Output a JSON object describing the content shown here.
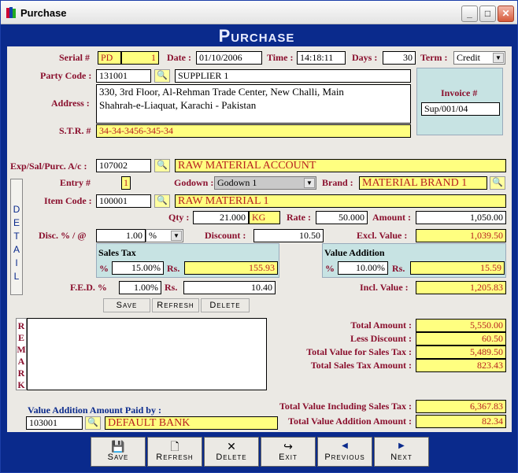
{
  "window": {
    "title": "Purchase"
  },
  "banner": "Purchase",
  "header": {
    "serial_label": "Serial #",
    "serial_prefix": "PD",
    "serial_no": "1",
    "date_label": "Date :",
    "date": "01/10/2006",
    "time_label": "Time :",
    "time": "14:18:11",
    "days_label": "Days :",
    "days": "30",
    "term_label": "Term :",
    "term": "Credit"
  },
  "party": {
    "code_label": "Party Code :",
    "code": "131001",
    "name": "SUPPLIER 1",
    "address_label": "Address :",
    "address_line1": "330, 3rd Floor, Al-Rehman Trade Center, New Challi, Main",
    "address_line2": "Shahrah-e-Liaquat, Karachi - Pakistan",
    "str_label": "S.T.R. #",
    "str": "34-34-3456-345-34"
  },
  "invoice": {
    "label": "Invoice #",
    "value": "Sup/001/04"
  },
  "account": {
    "label": "Exp/Sal/Purc. A/c :",
    "code": "107002",
    "name": "RAW MATERIAL ACCOUNT"
  },
  "detail": {
    "tab_letters": [
      "D",
      "E",
      "T",
      "A",
      "I",
      "L"
    ],
    "entry_label": "Entry #",
    "entry": "1",
    "godown_label": "Godown :",
    "godown": "Godown 1",
    "brand_label": "Brand :",
    "brand": "MATERIAL BRAND 1",
    "item_label": "Item Code :",
    "item_code": "100001",
    "item_name": "RAW MATERIAL 1",
    "qty_label": "Qty :",
    "qty": "21.000",
    "unit": "KG",
    "rate_label": "Rate :",
    "rate": "50.000",
    "amount_label": "Amount :",
    "amount": "1,050.00",
    "disc_label": "Disc. % / @",
    "disc": "1.00",
    "disc_type": "%",
    "discount_label": "Discount :",
    "discount": "10.50",
    "excl_label": "Excl. Value :",
    "excl": "1,039.50",
    "sales_tax_title": "Sales Tax",
    "pct_label": "%",
    "st_pct": "15.00%",
    "rs_label": "Rs.",
    "st_rs": "155.93",
    "va_title": "Value Addition",
    "va_pct": "10.00%",
    "va_rs": "15.59",
    "fed_label": "F.E.D. %",
    "fed_pct": "1.00%",
    "fed_rs": "10.40",
    "incl_label": "Incl. Value :",
    "incl": "1,205.83",
    "save": "Save",
    "refresh": "Refresh",
    "delete": "Delete"
  },
  "remark": {
    "letters": [
      "R",
      "E",
      "M",
      "A",
      "R",
      "K"
    ]
  },
  "totals": {
    "total_amount_label": "Total Amount :",
    "total_amount": "5,550.00",
    "less_discount_label": "Less Discount :",
    "less_discount": "60.50",
    "total_value_st_label": "Total Value for Sales Tax :",
    "total_value_st": "5,489.50",
    "total_st_label": "Total Sales Tax Amount :",
    "total_st": "823.43",
    "total_incl_label": "Total Value Including Sales Tax :",
    "total_incl": "6,367.83",
    "total_va_label": "Total Value Addition Amount :",
    "total_va": "82.34"
  },
  "va_paid": {
    "label": "Value Addition Amount Paid by :",
    "code": "103001",
    "name": "DEFAULT BANK"
  },
  "toolbar": {
    "save": "Save",
    "refresh": "Refresh",
    "delete": "Delete",
    "exit": "Exit",
    "previous": "Previous",
    "next": "Next"
  },
  "colors": {
    "frame": "#0a2a8c",
    "label": "#8a0f2d",
    "highlight": "#ffff80"
  }
}
